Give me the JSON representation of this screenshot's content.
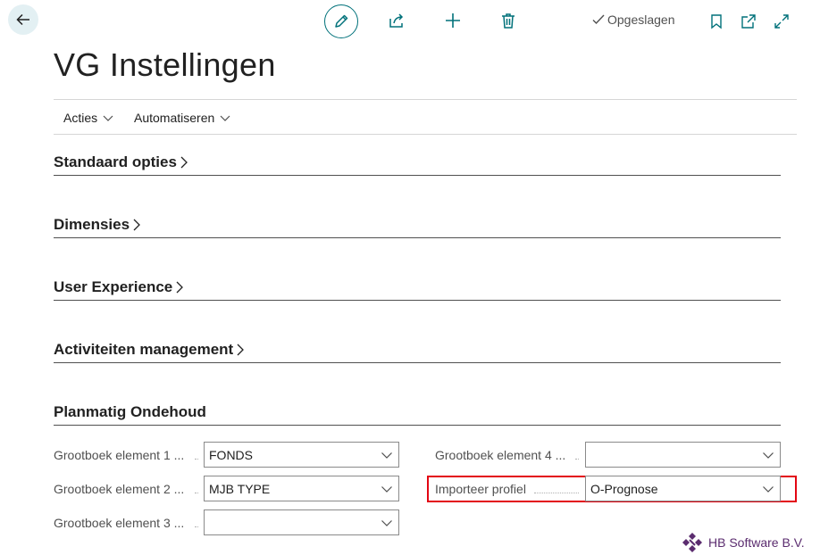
{
  "toolbar": {
    "back": "back",
    "edit": "edit",
    "share": "share",
    "new": "new",
    "delete": "delete",
    "status": "Opgeslagen"
  },
  "page": {
    "title": "VG Instellingen"
  },
  "actions": [
    {
      "label": "Acties"
    },
    {
      "label": "Automatiseren"
    }
  ],
  "sections": [
    {
      "title": "Standaard opties"
    },
    {
      "title": "Dimensies"
    },
    {
      "title": "User Experience"
    },
    {
      "title": "Activiteiten management"
    },
    {
      "title": "Planmatig Ondehoud"
    }
  ],
  "fields": {
    "left": [
      {
        "label": "Grootboek element 1 ...",
        "value": "FONDS"
      },
      {
        "label": "Grootboek element 2 ...",
        "value": "MJB TYPE"
      },
      {
        "label": "Grootboek element 3 ...",
        "value": ""
      }
    ],
    "right": [
      {
        "label": "Grootboek element 4 ...",
        "value": ""
      },
      {
        "label": "Importeer profiel",
        "value": "O-Prognose"
      }
    ]
  },
  "footer": {
    "brand": "HB Software B.V."
  },
  "colors": {
    "accent": "#00717a",
    "highlight": "#e30613",
    "brand": "#5b2c6f"
  }
}
